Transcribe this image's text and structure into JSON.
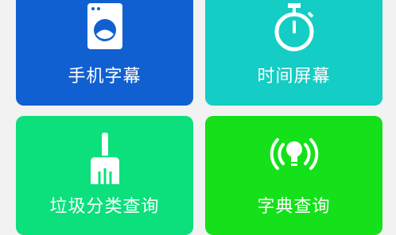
{
  "tiles": [
    {
      "label": "手机字幕",
      "icon": "washing-machine-icon",
      "color": "#1160d2"
    },
    {
      "label": "时间屏幕",
      "icon": "stopwatch-icon",
      "color": "#14cdc4"
    },
    {
      "label": "垃圾分类查询",
      "icon": "broom-icon",
      "color": "#0be07c"
    },
    {
      "label": "字典查询",
      "icon": "lightbulb-signal-icon",
      "color": "#14e11a"
    }
  ]
}
